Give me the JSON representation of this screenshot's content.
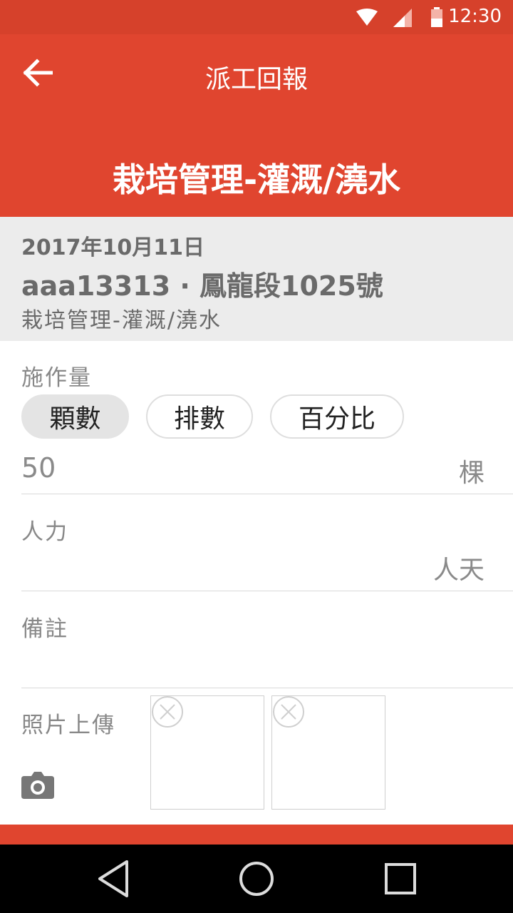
{
  "status": {
    "time": "12:30"
  },
  "header": {
    "title": "派工回報",
    "subtitle": "栽培管理-灌溉/澆水"
  },
  "info": {
    "date": "2017年10月11日",
    "field": "aaa13313 · 鳳龍段1025號",
    "task": "栽培管理-灌溉/澆水"
  },
  "work": {
    "label": "施作量",
    "chips": [
      "顆數",
      "排數",
      "百分比"
    ],
    "selected_chip": "顆數",
    "value": "50",
    "unit": "棵"
  },
  "labor": {
    "label": "人力",
    "unit": "人天"
  },
  "notes": {
    "label": "備註"
  },
  "photos": {
    "label": "照片上傳",
    "count": 2
  },
  "colors": {
    "accent": "#e0452f",
    "statusbar": "#d6412b"
  },
  "icons": [
    "back-arrow-icon",
    "wifi-icon",
    "signal-icon",
    "battery-icon",
    "close-circle-icon",
    "camera-icon",
    "nav-back-icon",
    "nav-home-icon",
    "nav-recents-icon"
  ]
}
